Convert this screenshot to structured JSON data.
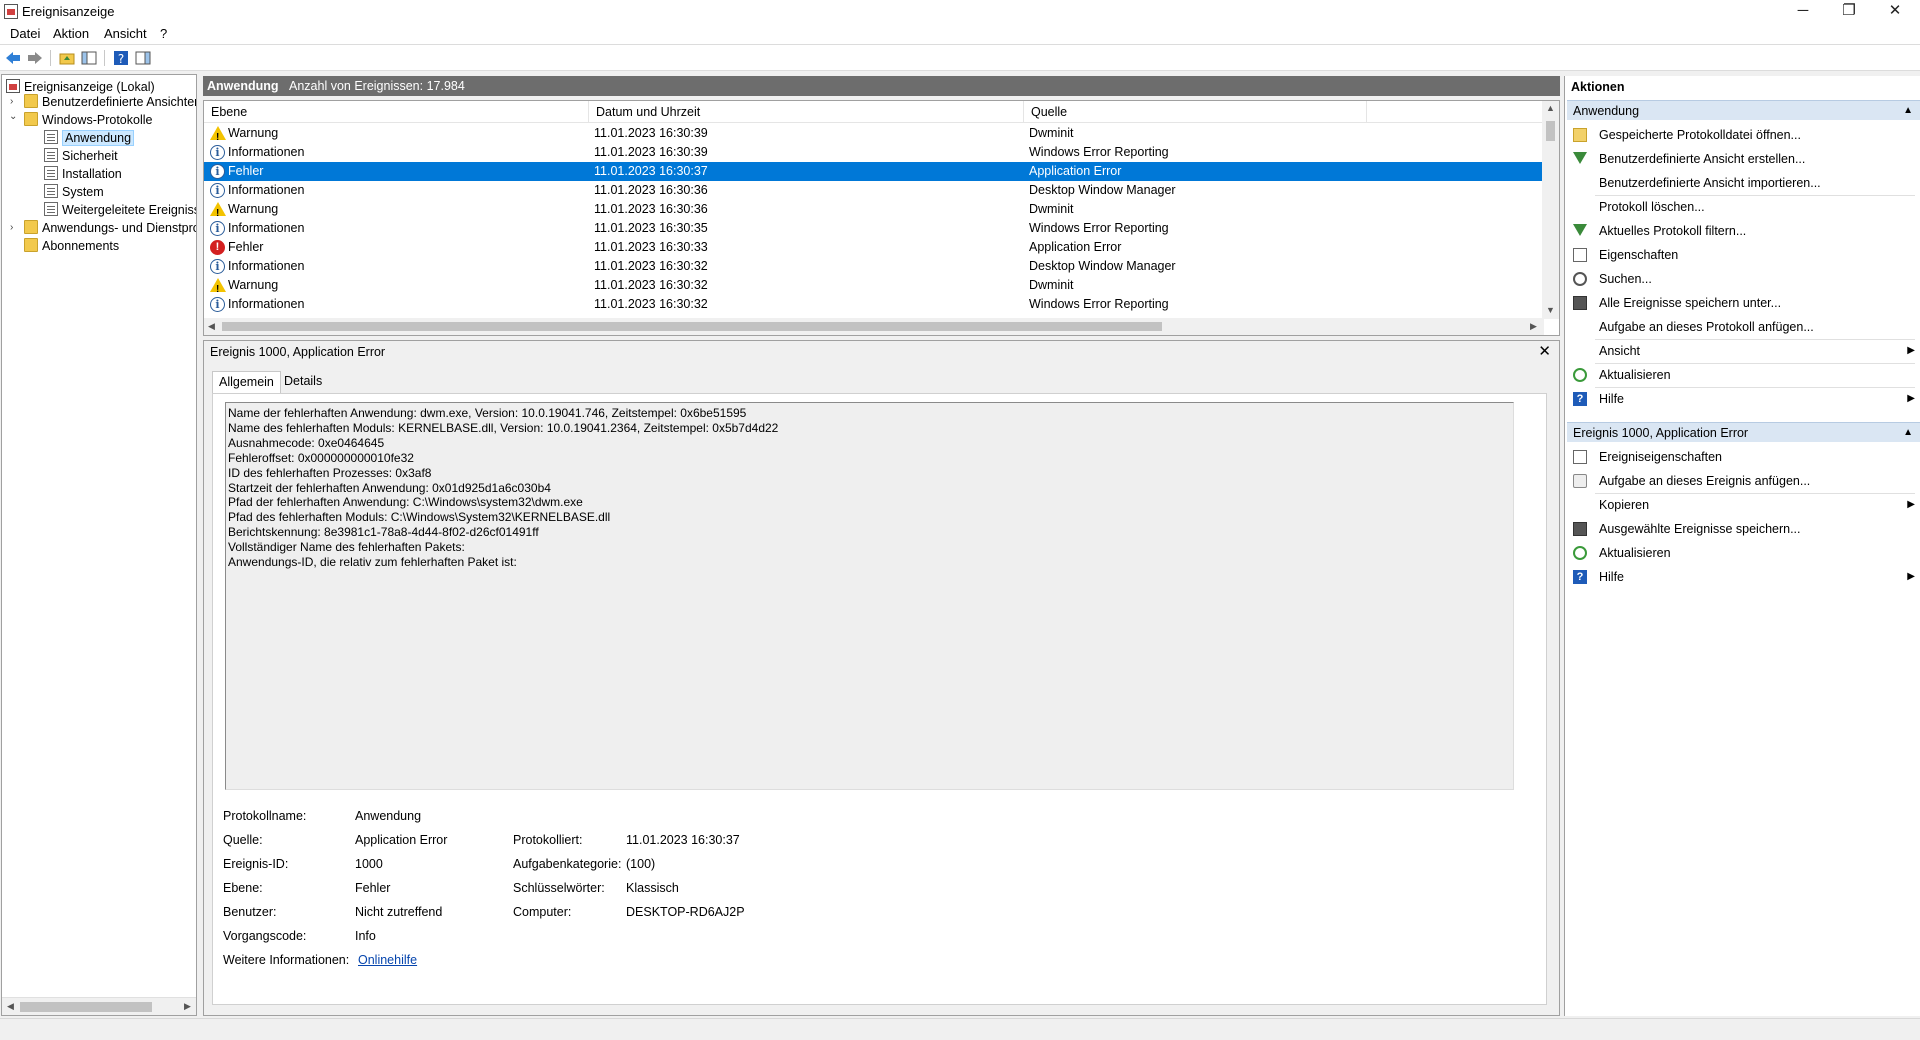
{
  "window": {
    "title": "Ereignisanzeige",
    "controls": {
      "minimize": "─",
      "maximize": "❐",
      "close": "✕"
    }
  },
  "menu": {
    "items": [
      "Datei",
      "Aktion",
      "Ansicht",
      "?"
    ]
  },
  "toolbar": {
    "icons": [
      "back-arrow-icon",
      "forward-arrow-icon",
      "folder-up-icon",
      "show-hide-tree-icon",
      "help-icon",
      "show-hide-actions-icon"
    ]
  },
  "tree": {
    "root": "Ereignisanzeige (Lokal)",
    "custom_views": "Benutzerdefinierte Ansichten",
    "windows_logs": "Windows-Protokolle",
    "logs": [
      "Anwendung",
      "Sicherheit",
      "Installation",
      "System",
      "Weitergeleitete Ereignisse"
    ],
    "app_services": "Anwendungs- und Dienstprotokolle",
    "subscriptions": "Abonnements"
  },
  "center": {
    "log_name": "Anwendung",
    "event_count": "Anzahl von Ereignissen: 17.984",
    "columns": [
      "Ebene",
      "Datum und Uhrzeit",
      "Quelle"
    ],
    "rows": [
      {
        "level": "Warnung",
        "icon": "warning-icon",
        "date": "11.01.2023 16:30:39",
        "source": "Dwminit"
      },
      {
        "level": "Informationen",
        "icon": "info-icon",
        "date": "11.01.2023 16:30:39",
        "source": "Windows Error Reporting"
      },
      {
        "level": "Fehler",
        "icon": "info-icon",
        "date": "11.01.2023 16:30:37",
        "source": "Application Error",
        "selected": true
      },
      {
        "level": "Informationen",
        "icon": "info-icon",
        "date": "11.01.2023 16:30:36",
        "source": "Desktop Window Manager"
      },
      {
        "level": "Warnung",
        "icon": "warning-icon",
        "date": "11.01.2023 16:30:36",
        "source": "Dwminit"
      },
      {
        "level": "Informationen",
        "icon": "info-icon",
        "date": "11.01.2023 16:30:35",
        "source": "Windows Error Reporting"
      },
      {
        "level": "Fehler",
        "icon": "error-icon",
        "date": "11.01.2023 16:30:33",
        "source": "Application Error"
      },
      {
        "level": "Informationen",
        "icon": "info-icon",
        "date": "11.01.2023 16:30:32",
        "source": "Desktop Window Manager"
      },
      {
        "level": "Warnung",
        "icon": "warning-icon",
        "date": "11.01.2023 16:30:32",
        "source": "Dwminit"
      },
      {
        "level": "Informationen",
        "icon": "info-icon",
        "date": "11.01.2023 16:30:32",
        "source": "Windows Error Reporting"
      }
    ]
  },
  "details": {
    "title": "Ereignis 1000, Application Error",
    "tabs": [
      "Allgemein",
      "Details"
    ],
    "message_lines": [
      "Name der fehlerhaften Anwendung: dwm.exe, Version: 10.0.19041.746, Zeitstempel: 0x6be51595",
      "Name des fehlerhaften Moduls: KERNELBASE.dll, Version: 10.0.19041.2364, Zeitstempel: 0x5b7d4d22",
      "Ausnahmecode: 0xe0464645",
      "Fehleroffset: 0x000000000010fe32",
      "ID des fehlerhaften Prozesses: 0x3af8",
      "Startzeit der fehlerhaften Anwendung: 0x01d925d1a6c030b4",
      "Pfad der fehlerhaften Anwendung: C:\\Windows\\system32\\dwm.exe",
      "Pfad des fehlerhaften Moduls: C:\\Windows\\System32\\KERNELBASE.dll",
      "Berichtskennung: 8e3981c1-78a8-4d44-8f02-d26cf01491ff",
      "Vollständiger Name des fehlerhaften Pakets:",
      "Anwendungs-ID, die relativ zum fehlerhaften Paket ist:"
    ],
    "props": {
      "log_label": "Protokollname:",
      "log_value": "Anwendung",
      "source_label": "Quelle:",
      "source_value": "Application Error",
      "logged_label": "Protokolliert:",
      "logged_value": "11.01.2023 16:30:37",
      "eventid_label": "Ereignis-ID:",
      "eventid_value": "1000",
      "task_label": "Aufgabenkategorie:",
      "task_value": "(100)",
      "level_label": "Ebene:",
      "level_value": "Fehler",
      "keywords_label": "Schlüsselwörter:",
      "keywords_value": "Klassisch",
      "user_label": "Benutzer:",
      "user_value": "Nicht zutreffend",
      "computer_label": "Computer:",
      "computer_value": "DESKTOP-RD6AJ2P",
      "opcode_label": "Vorgangscode:",
      "opcode_value": "Info",
      "more_label": "Weitere Informationen:",
      "more_link": "Onlinehilfe"
    }
  },
  "actions": {
    "header": "Aktionen",
    "section1": "Anwendung",
    "section1_items": [
      {
        "label": "Gespeicherte Protokolldatei öffnen...",
        "icon": "open-log-icon"
      },
      {
        "label": "Benutzerdefinierte Ansicht erstellen...",
        "icon": "filter-icon"
      },
      {
        "label": "Benutzerdefinierte Ansicht importieren...",
        "icon": ""
      },
      {
        "label": "Protokoll löschen...",
        "icon": ""
      },
      {
        "label": "Aktuelles Protokoll filtern...",
        "icon": "filter-icon"
      },
      {
        "label": "Eigenschaften",
        "icon": "properties-icon"
      },
      {
        "label": "Suchen...",
        "icon": "find-icon"
      },
      {
        "label": "Alle Ereignisse speichern unter...",
        "icon": "save-icon"
      },
      {
        "label": "Aufgabe an dieses Protokoll anfügen...",
        "icon": ""
      },
      {
        "label": "Ansicht",
        "icon": "",
        "submenu": true
      },
      {
        "label": "Aktualisieren",
        "icon": "refresh-icon"
      },
      {
        "label": "Hilfe",
        "icon": "help-icon",
        "submenu": true
      }
    ],
    "section2": "Ereignis 1000, Application Error",
    "section2_items": [
      {
        "label": "Ereigniseigenschaften",
        "icon": "properties-icon"
      },
      {
        "label": "Aufgabe an dieses Ereignis anfügen...",
        "icon": "attach-task-icon"
      },
      {
        "label": "Kopieren",
        "icon": "",
        "submenu": true
      },
      {
        "label": "Ausgewählte Ereignisse speichern...",
        "icon": "save-icon"
      },
      {
        "label": "Aktualisieren",
        "icon": "refresh-icon"
      },
      {
        "label": "Hilfe",
        "icon": "help-icon",
        "submenu": true
      }
    ]
  },
  "colors": {
    "selection": "#0078d7",
    "header_bg": "#6d6d6d",
    "section_bg": "#dae6f3",
    "link": "#0645ad"
  }
}
